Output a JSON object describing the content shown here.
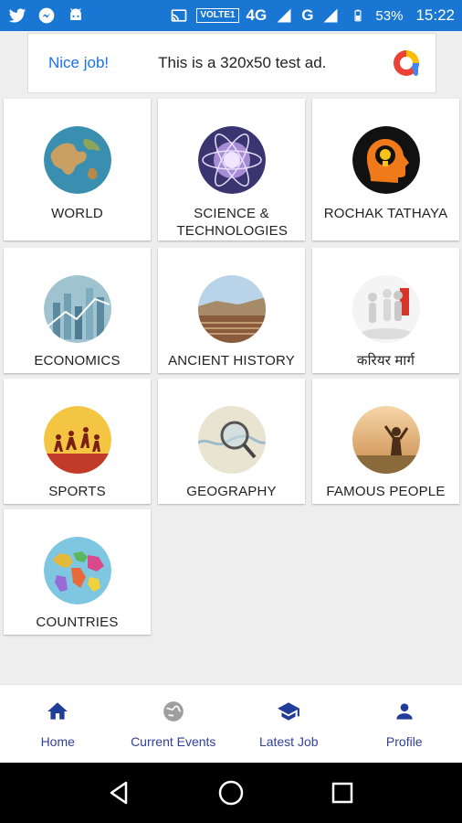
{
  "status_bar": {
    "left_icons": [
      "twitter-icon",
      "messenger-icon",
      "android-icon"
    ],
    "volte": "VOLTE1",
    "network_1": "4G",
    "network_2": "G",
    "battery": "53%",
    "time": "15:22",
    "color": "#1976d2"
  },
  "ad": {
    "nice_job": "Nice job!",
    "text": "This is a 320x50 test ad."
  },
  "categories": [
    {
      "label": "WORLD",
      "icon": "globe-image"
    },
    {
      "label": "SCIENCE & TECHNOLOGIES",
      "icon": "science-image"
    },
    {
      "label": "ROCHAK TATHAYA",
      "icon": "idea-head-image"
    },
    {
      "label": "ECONOMICS",
      "icon": "economics-image"
    },
    {
      "label": "ANCIENT HISTORY",
      "icon": "ancient-history-image"
    },
    {
      "label": "करियर मार्ग",
      "icon": "career-image"
    },
    {
      "label": "SPORTS",
      "icon": "sports-image"
    },
    {
      "label": "GEOGRAPHY",
      "icon": "geography-image"
    },
    {
      "label": "FAMOUS PEOPLE",
      "icon": "famous-people-image"
    },
    {
      "label": "COUNTRIES",
      "icon": "countries-map-image"
    }
  ],
  "bottom_nav": [
    {
      "label": "Home",
      "icon": "home-icon"
    },
    {
      "label": "Current Events",
      "icon": "globe-icon"
    },
    {
      "label": "Latest Job",
      "icon": "graduation-cap-icon"
    },
    {
      "label": "Profile",
      "icon": "person-icon"
    }
  ],
  "colors": {
    "nav_text": "#2f3f9a",
    "active_icon": "#1f3d99",
    "inactive_icon": "#9e9e9e"
  }
}
